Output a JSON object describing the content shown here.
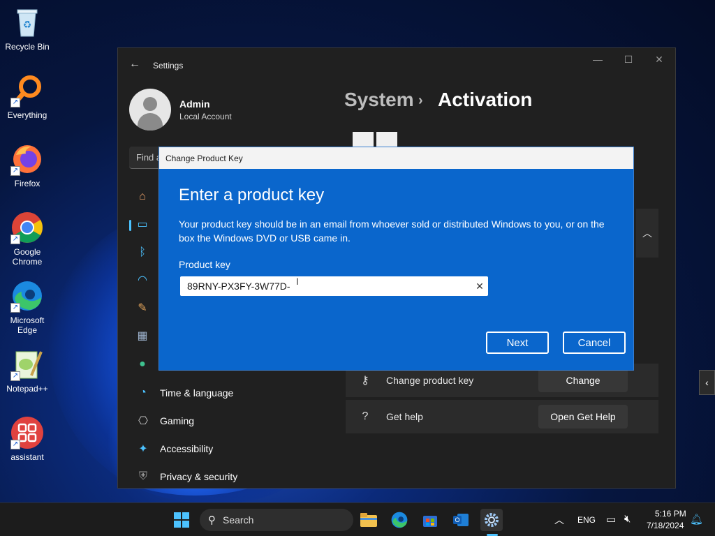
{
  "desktop": {
    "icons": [
      {
        "label": "Recycle Bin"
      },
      {
        "label": "Everything"
      },
      {
        "label": "Firefox"
      },
      {
        "label": "Google Chrome"
      },
      {
        "label": "Microsoft Edge"
      },
      {
        "label": "Notepad++"
      },
      {
        "label": "assistant"
      }
    ]
  },
  "settings": {
    "window_title": "Settings",
    "user": {
      "name": "Admin",
      "account_type": "Local Account"
    },
    "find_placeholder": "Find a",
    "nav_items": [
      {
        "label": "Time & language"
      },
      {
        "label": "Gaming"
      },
      {
        "label": "Accessibility"
      },
      {
        "label": "Privacy & security"
      }
    ],
    "breadcrumb": {
      "parent": "System",
      "separator": "›",
      "current": "Activation"
    },
    "rows": [
      {
        "label": "Change product key",
        "button": "Change"
      },
      {
        "label": "Get help",
        "button": "Open Get Help"
      }
    ]
  },
  "dialog": {
    "title": "Change Product Key",
    "heading": "Enter a product key",
    "description": "Your product key should be in an email from whoever sold or distributed Windows to you, or on the box the Windows DVD or USB came in.",
    "field_label": "Product key",
    "field_value": "89RNY-PX3FY-3W77D-",
    "next_label": "Next",
    "cancel_label": "Cancel"
  },
  "taskbar": {
    "search_label": "Search",
    "language": "ENG",
    "time": "5:16 PM",
    "date": "7/18/2024"
  },
  "colors": {
    "accent": "#4cc2ff",
    "dialog_bg": "#0a66cc",
    "window_bg": "#202020"
  }
}
